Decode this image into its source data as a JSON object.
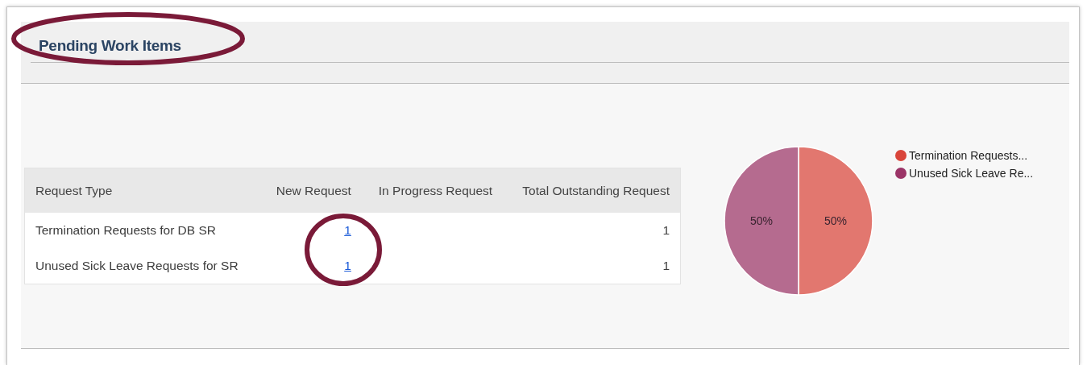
{
  "panel": {
    "title": "Pending Work Items"
  },
  "table": {
    "columns": [
      "Request Type",
      "New Request",
      "In Progress Request",
      "Total Outstanding Request"
    ],
    "rows": [
      {
        "request_type": "Termination Requests for DB SR",
        "new_request": "1",
        "total_outstanding_request": "1"
      },
      {
        "request_type": "Unused Sick Leave Requests for SR",
        "new_request": "1",
        "total_outstanding_request": "1"
      }
    ]
  },
  "chart_data": {
    "type": "pie",
    "categories": [
      "Termination Requests...",
      "Unused Sick Leave Re..."
    ],
    "values": [
      50,
      50
    ],
    "colors": [
      "#d9453a",
      "#9b3467"
    ],
    "value_labels": [
      "50%",
      "50%"
    ]
  },
  "annotations": [
    {
      "kind": "ellipse"
    },
    {
      "kind": "ellipse"
    }
  ]
}
